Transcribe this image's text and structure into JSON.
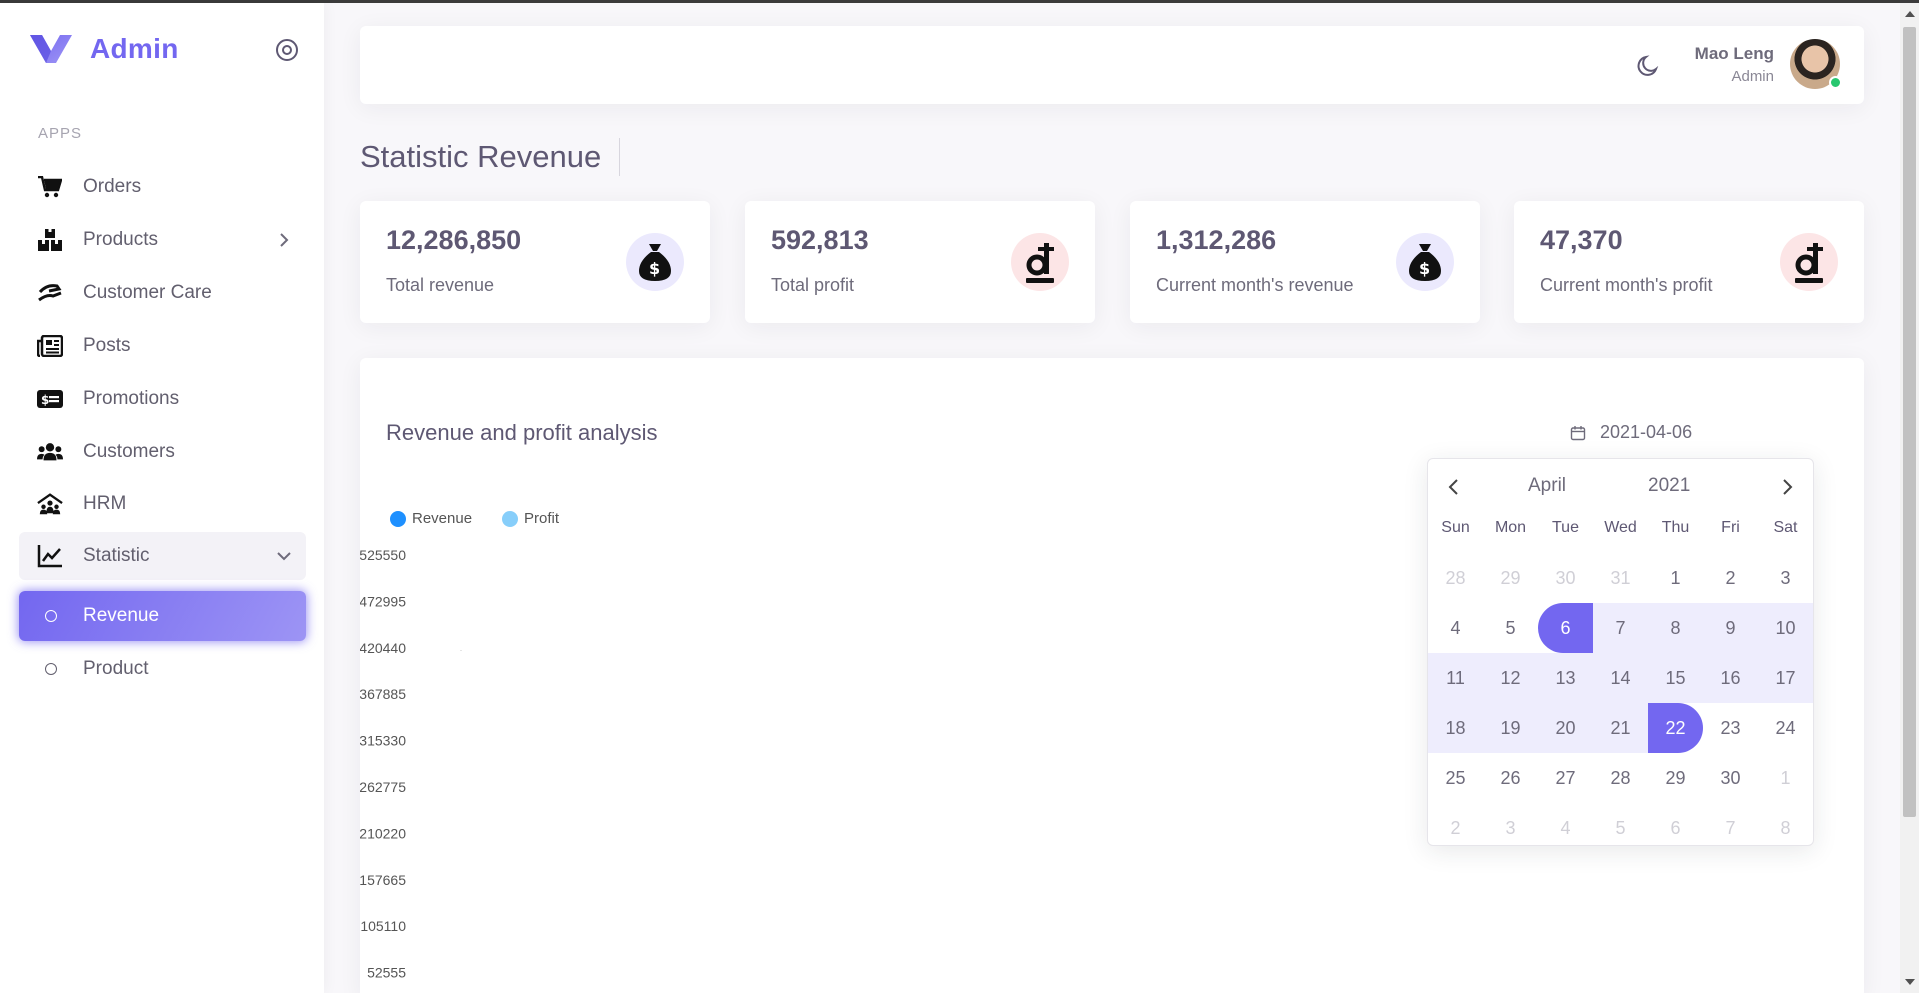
{
  "brand": {
    "name": "Admin"
  },
  "sidebar": {
    "section_label": "APPS",
    "items": [
      {
        "label": "Orders",
        "icon": "cart-icon"
      },
      {
        "label": "Products",
        "icon": "boxes-icon"
      },
      {
        "label": "Customer Care",
        "icon": "hand-holding-icon"
      },
      {
        "label": "Posts",
        "icon": "newspaper-icon"
      },
      {
        "label": "Promotions",
        "icon": "money-bill-icon"
      },
      {
        "label": "Customers",
        "icon": "users-icon"
      },
      {
        "label": "HRM",
        "icon": "people-roof-icon"
      },
      {
        "label": "Statistic",
        "icon": "chart-line-icon"
      }
    ],
    "sub_items": [
      {
        "label": "Revenue"
      },
      {
        "label": "Product"
      }
    ]
  },
  "header": {
    "user_name": "Mao Leng",
    "user_role": "Admin"
  },
  "page": {
    "title": "Statistic Revenue"
  },
  "stats": [
    {
      "value": "12,286,850",
      "label": "Total revenue",
      "icon": "money-bag-icon",
      "tone": "purple"
    },
    {
      "value": "592,813",
      "label": "Total profit",
      "icon": "dong-icon",
      "tone": "red"
    },
    {
      "value": "1,312,286",
      "label": "Current month's revenue",
      "icon": "money-bag-icon",
      "tone": "purple"
    },
    {
      "value": "47,370",
      "label": "Current month's profit",
      "icon": "dong-icon",
      "tone": "red"
    }
  ],
  "analysis": {
    "title": "Revenue and profit analysis",
    "date_value": "2021-04-06"
  },
  "chart_data": {
    "type": "bar",
    "title": "",
    "series": [
      {
        "name": "Revenue",
        "color": "#1e90ff",
        "values": []
      },
      {
        "name": "Profit",
        "color": "#87cefa",
        "values": []
      }
    ],
    "y_ticks": [
      "525550",
      "472995",
      "420440",
      "367885",
      "315330",
      "262775",
      "210220",
      "157665",
      "105110",
      "52555"
    ]
  },
  "calendar": {
    "month": "April",
    "year": "2021",
    "weekdays": [
      "Sun",
      "Mon",
      "Tue",
      "Wed",
      "Thu",
      "Fri",
      "Sat"
    ],
    "weeks": [
      [
        "28",
        "29",
        "30",
        "31",
        "1",
        "2",
        "3"
      ],
      [
        "4",
        "5",
        "6",
        "7",
        "8",
        "9",
        "10"
      ],
      [
        "11",
        "12",
        "13",
        "14",
        "15",
        "16",
        "17"
      ],
      [
        "18",
        "19",
        "20",
        "21",
        "22",
        "23",
        "24"
      ],
      [
        "25",
        "26",
        "27",
        "28",
        "29",
        "30",
        "1"
      ],
      [
        "2",
        "3",
        "4",
        "5",
        "6",
        "7",
        "8"
      ]
    ],
    "range_start": "6",
    "range_end": "22"
  }
}
